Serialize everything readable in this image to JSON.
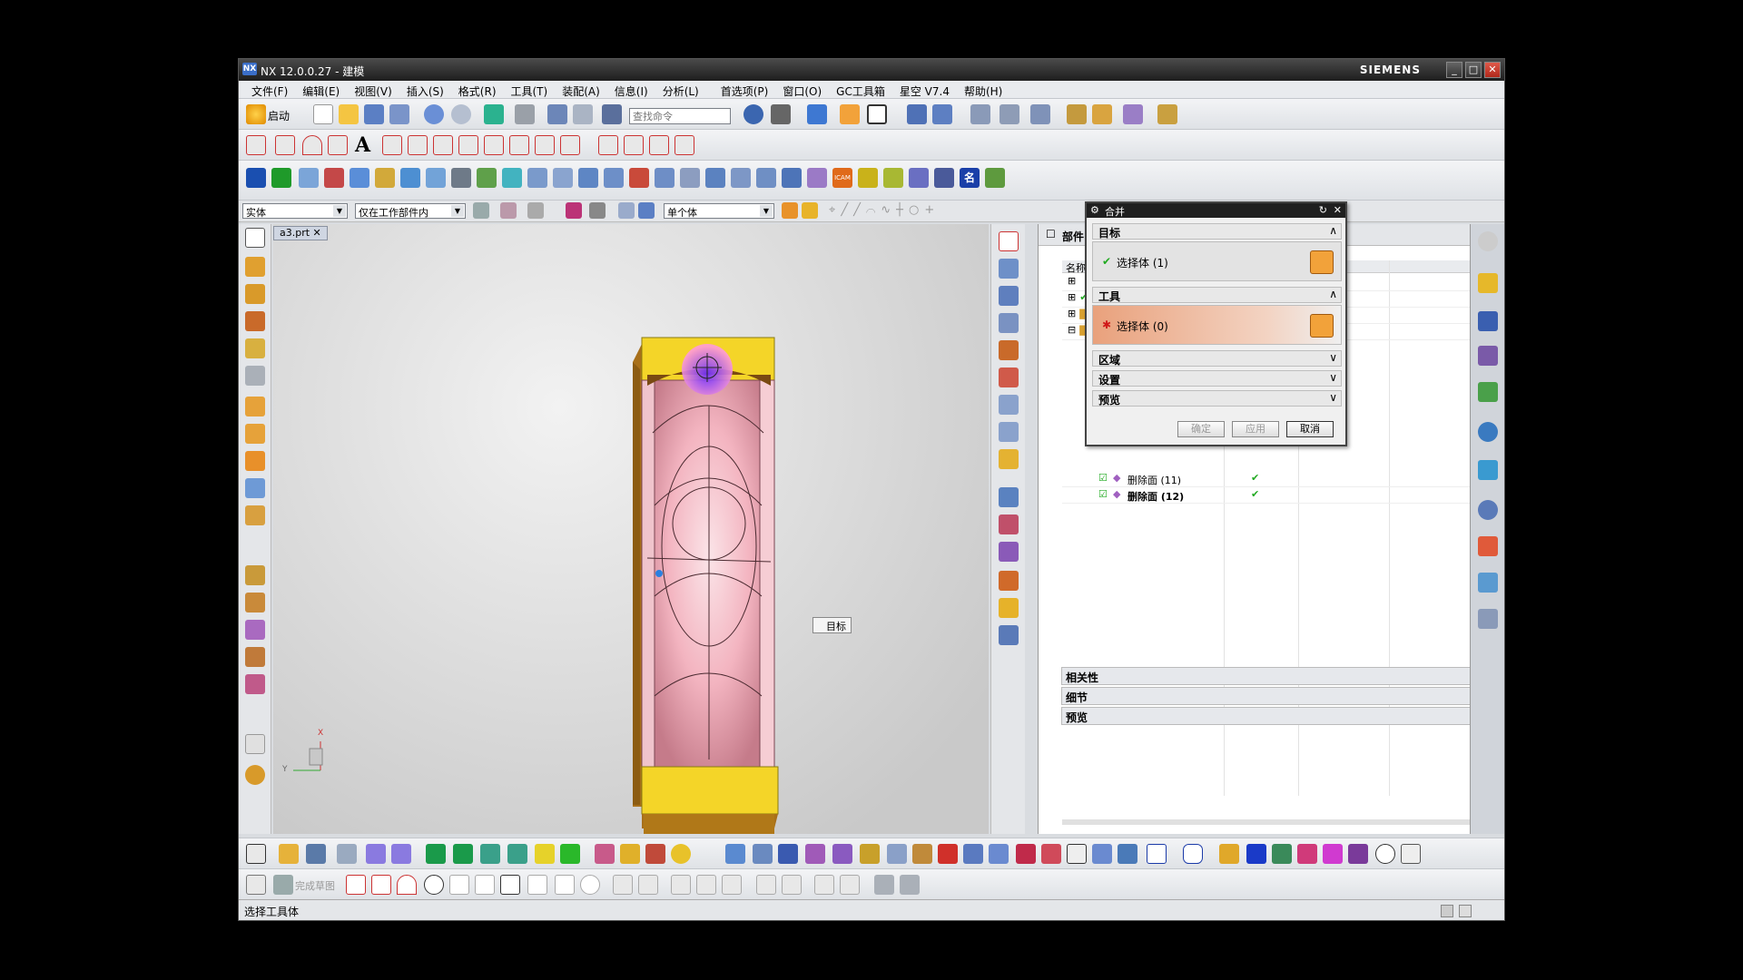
{
  "window": {
    "title": "NX 12.0.0.27 - 建模",
    "brand": "SIEMENS",
    "logo": "NX"
  },
  "menu": [
    "文件(F)",
    "编辑(E)",
    "视图(V)",
    "插入(S)",
    "格式(R)",
    "工具(T)",
    "装配(A)",
    "信息(I)",
    "分析(L)",
    "首选项(P)",
    "窗口(O)",
    "GC工具箱",
    "星空 V7.4",
    "帮助(H)"
  ],
  "toolbar": {
    "start_label": "启动",
    "search_placeholder": "查找命令"
  },
  "selbar": {
    "filter": "实体",
    "scope": "仅在工作部件内",
    "body": "单个体"
  },
  "viewport": {
    "tab": "a3.prt",
    "tooltip": "目标",
    "axis_x": "X",
    "axis_y": "Y"
  },
  "navigator": {
    "header": "部件",
    "col_name": "名称",
    "rows": [
      {
        "label": "删除面 (11)"
      },
      {
        "label": "删除面 (12)"
      }
    ]
  },
  "nav_sections": [
    "相关性",
    "细节",
    "预览"
  ],
  "dialog": {
    "title": "合并",
    "target_group": "目标",
    "target_select": "选择体 (1)",
    "tool_group": "工具",
    "tool_select": "选择体 (0)",
    "groups": [
      "区域",
      "设置",
      "预览"
    ],
    "ok": "确定",
    "apply": "应用",
    "cancel": "取消"
  },
  "bottom": {
    "sketch_label": "完成草图"
  },
  "status": "选择工具体",
  "colors": {
    "part_body": "#f3b4c0",
    "part_end": "#f4d528",
    "part_side": "#b07818",
    "check": "#22aa22",
    "required": "#d01818",
    "title_bg": "#1f1f1f"
  }
}
